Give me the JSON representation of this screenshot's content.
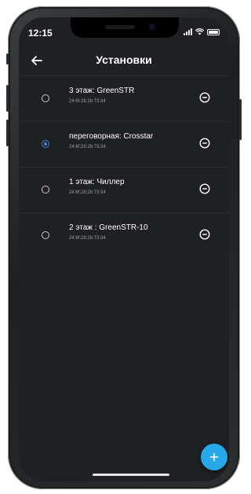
{
  "status_bar": {
    "time": "12:15"
  },
  "header": {
    "title": "Установки",
    "back_icon": "arrow-left-icon"
  },
  "devices": [
    {
      "name": "3 этаж: GreenSTR",
      "mac": "24:6f:28:2b:73:34",
      "selected": false
    },
    {
      "name": "переговорная: Crosstar",
      "mac": "24:6f:28:2b:73:34",
      "selected": true
    },
    {
      "name": "1 этаж: Чиллер",
      "mac": "24:6f:28:2b:73:34",
      "selected": false
    },
    {
      "name": "2 этаж : GreenSTR-10",
      "mac": "24:6f:28:2b:73:34",
      "selected": false
    }
  ],
  "fab": {
    "icon": "plus-icon",
    "label": "+"
  },
  "colors": {
    "background": "#1f2023",
    "accent_radio": "#4a84d8",
    "fab": "#27a8e8",
    "text_primary": "#ffffff",
    "text_secondary": "#9d9ea2"
  }
}
